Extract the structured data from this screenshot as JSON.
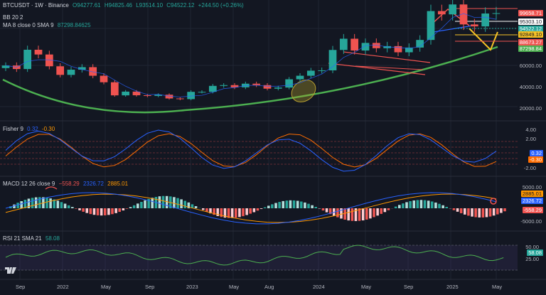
{
  "header": {
    "symbol": "BTCUSDT · 1W · Binance",
    "open": "O94277.61",
    "high": "H94825.46",
    "low": "L93514.10",
    "close": "C94522.12",
    "change": "+244.50 (+0.26%)",
    "ma_label": "MA 8 close 0 SMA 9",
    "ma_value": "87298.84625",
    "bb_label": "BB 20 2"
  },
  "fisher": {
    "label": "Fisher 9",
    "v1": "0.32",
    "v2": "-0.30"
  },
  "macd": {
    "label": "MACD 12 26 close 9",
    "hist": "−558.29",
    "macd": "2326.72",
    "signal": "2885.01"
  },
  "rsi": {
    "label": "RSI 21 SMA 21",
    "value": "58.08"
  },
  "price_labels": [
    {
      "text": "99658.71",
      "bg": "#ef5350",
      "color": "#ffffff"
    },
    {
      "text": "95303.10",
      "bg": "#ffffff",
      "color": "#131722"
    },
    {
      "text": "94522.12",
      "bg": "#26a69a",
      "color": "#ffffff"
    },
    {
      "text": "92849.10",
      "bg": "#f7c325",
      "color": "#131722"
    },
    {
      "text": "88673.27",
      "bg": "#ef5350",
      "color": "#ffffff"
    },
    {
      "text": "87298.84",
      "bg": "#4caf50",
      "color": "#ffffff"
    }
  ],
  "price_ticks": [
    "60000.00",
    "40000.00",
    "20000.00"
  ],
  "fisher_ticks": [
    "4.00",
    "2.00",
    "-2.00"
  ],
  "fisher_labels": [
    {
      "text": "0.32",
      "bg": "#2962ff"
    },
    {
      "text": "-0.30",
      "bg": "#ff6d00"
    }
  ],
  "macd_labels": [
    {
      "text": "2885.01",
      "bg": "#ff9800",
      "color": "#131722"
    },
    {
      "text": "2326.72",
      "bg": "#2962ff",
      "color": "#ffffff"
    },
    {
      "text": "-558.29",
      "bg": "#ef5350",
      "color": "#ffffff"
    }
  ],
  "macd_ticks": [
    "5000.00",
    "-5000.00"
  ],
  "rsi_labels": [
    {
      "text": "58.08",
      "bg": "#26a69a"
    }
  ],
  "rsi_ticks": [
    "50.00",
    "25.00"
  ],
  "time_axis": [
    "Sep",
    "2022",
    "May",
    "Sep",
    "2023",
    "May",
    "Aug",
    "2024",
    "May",
    "Sep",
    "2025",
    "May"
  ],
  "colors": {
    "background": "#131722",
    "up": "#26a69a",
    "down": "#ef5350",
    "curve": "#4caf50",
    "macd_line": "#2962ff",
    "signal_line": "#ff9800",
    "rsi_line": "#4caf50"
  },
  "chart_data": {
    "type": "candlestick",
    "series": [
      {
        "name": "BTCUSDT",
        "x": [
          "2021-08",
          "2021-09",
          "2021-10",
          "2021-11",
          "2021-12",
          "2022-01",
          "2022-02",
          "2022-03",
          "2022-04",
          "2022-05",
          "2022-06",
          "2022-07",
          "2022-08",
          "2022-09",
          "2022-10",
          "2022-11",
          "2022-12",
          "2023-01",
          "2023-02",
          "2023-03",
          "2023-04",
          "2023-05",
          "2023-06",
          "2023-07",
          "2023-08",
          "2023-09",
          "2023-10",
          "2023-11",
          "2023-12",
          "2024-01",
          "2024-02",
          "2024-03",
          "2024-04",
          "2024-05",
          "2024-06",
          "2024-07",
          "2024-08",
          "2024-09",
          "2024-10",
          "2024-11",
          "2024-12",
          "2025-01",
          "2025-02",
          "2025-03",
          "2025-04",
          "2025-05"
        ],
        "values": [
          47000,
          43800,
          61300,
          57000,
          46300,
          38500,
          43200,
          45500,
          37700,
          31800,
          19900,
          23300,
          20000,
          19400,
          20500,
          17100,
          16500,
          23100,
          23100,
          28500,
          29200,
          27200,
          30500,
          29200,
          26000,
          27000,
          34500,
          37700,
          42300,
          42600,
          61100,
          71300,
          60600,
          67500,
          62700,
          64600,
          59000,
          63300,
          70200,
          96400,
          93400,
          102400,
          84300,
          82500,
          94200,
          94500
        ]
      }
    ],
    "ylim": [
      0,
      100000
    ]
  }
}
